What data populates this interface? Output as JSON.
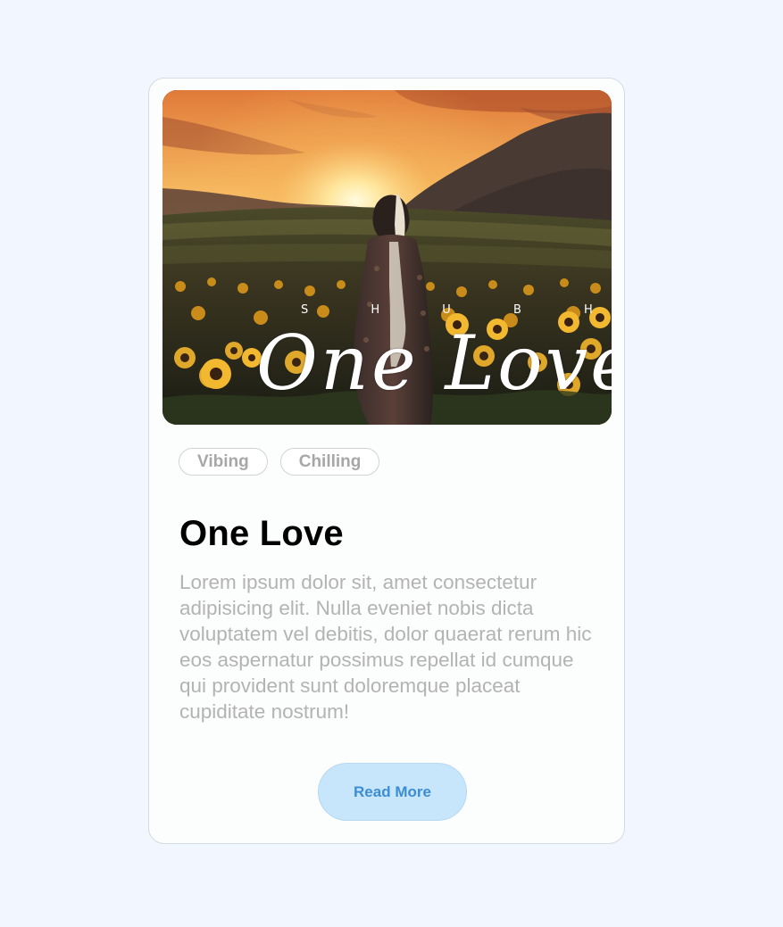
{
  "card": {
    "cover": {
      "artist": "S H U B H",
      "album_title": "One Love"
    },
    "tags": [
      "Vibing",
      "Chilling"
    ],
    "title": "One Love",
    "description": "Lorem ipsum dolor sit, amet consectetur adipisicing elit. Nulla eveniet nobis dicta voluptatem vel debitis, dolor quaerat rerum hic eos aspernatur possimus repellat id cumque qui provident sunt doloremque placeat cupiditate nostrum!",
    "button_label": "Read More"
  },
  "colors": {
    "page_background": "#f2f7ff",
    "card_background": "#fcfdfd",
    "button_background": "#c7e5fb",
    "button_text": "#3b8ed4",
    "tag_text": "#a7a7a7",
    "description_text": "#b3b3b3"
  }
}
